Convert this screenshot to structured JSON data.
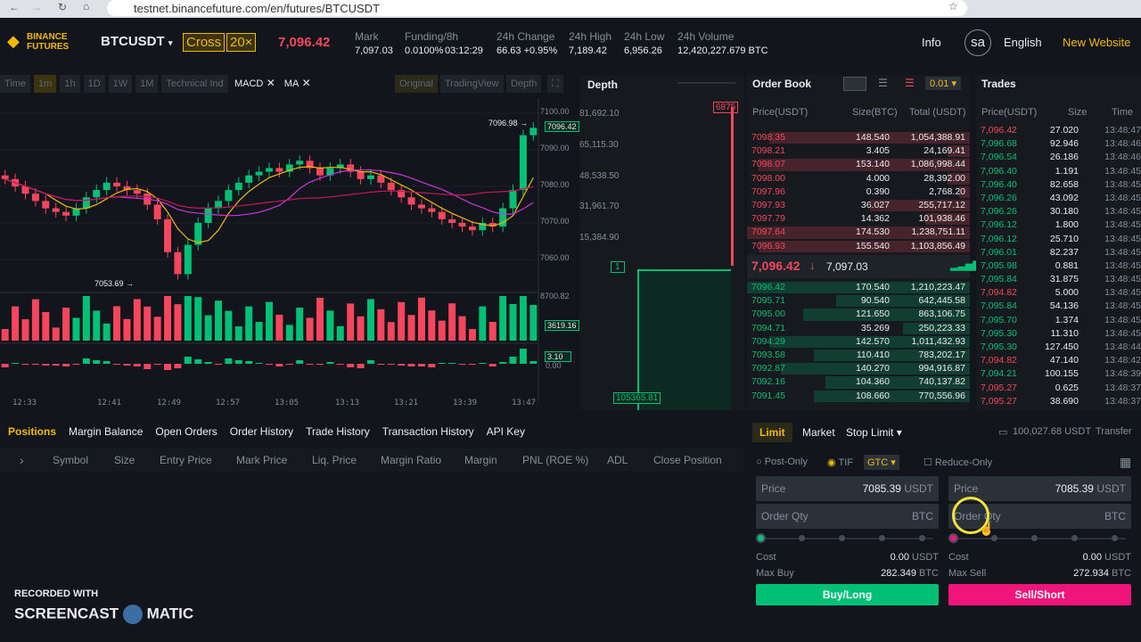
{
  "browser": {
    "url": "testnet.binancefuture.com/en/futures/BTCUSDT"
  },
  "header": {
    "logo": "BINANCE FUTURES",
    "symbol": "BTCUSDT",
    "margin_mode": "Cross",
    "leverage": "20×",
    "last_price": "7,096.42",
    "mark_label": "Mark",
    "mark_value": "7,097.03",
    "funding_label": "Funding/8h",
    "funding_rate": "0.0100%",
    "funding_countdown": "03:12:29",
    "change_label": "24h Change",
    "change_value": "66.63 +0.95%",
    "high_label": "24h High",
    "high_value": "7,189.42",
    "low_label": "24h Low",
    "low_value": "6,956.26",
    "volume_label": "24h Volume",
    "volume_value": "12,420,227.679 BTC",
    "info": "Info",
    "avatar": "sa",
    "language": "English",
    "new_website": "New Website"
  },
  "chart_toolbar": {
    "items": [
      "Time",
      "1m",
      "1h",
      "1D",
      "1W",
      "1M",
      "Technical Ind"
    ],
    "indicators": [
      "MACD",
      "MA"
    ],
    "views": [
      "Original",
      "TradingView",
      "Depth"
    ]
  },
  "chart": {
    "y_ticks": [
      "7100.00",
      "7090.00",
      "7080.00",
      "7070.00",
      "7060.00"
    ],
    "vol_max": "8700.82",
    "current_price_tag": "7096.42",
    "high_marker": "7096.98",
    "low_marker": "7053.69",
    "volume_tag": "3619.16",
    "macd_tag": "3.10",
    "macd_zero": "0.00",
    "x_ticks": [
      "12:33",
      "12:41",
      "12:49",
      "12:57",
      "13:05",
      "13:13",
      "13:21",
      "13:39",
      "13:47"
    ],
    "closes": [
      7082,
      7080,
      7078,
      7076,
      7074,
      7073,
      7072,
      7074,
      7077,
      7079,
      7081,
      7080,
      7079,
      7078,
      7075,
      7071,
      7062,
      7056,
      7064,
      7070,
      7074,
      7076,
      7079,
      7081,
      7083,
      7084,
      7085,
      7084,
      7086,
      7087,
      7085,
      7083,
      7085,
      7086,
      7084,
      7082,
      7083,
      7081,
      7079,
      7077,
      7075,
      7074,
      7073,
      7071,
      7070,
      7069,
      7068,
      7070,
      7069,
      7074,
      7079,
      7094,
      7096
    ]
  },
  "depth": {
    "title": "Depth",
    "y_ticks": [
      "81,692.10",
      "65,115.30",
      "48,538.50",
      "31,961.70",
      "15,384.90"
    ],
    "ask_tag": "6875",
    "bid_tag": "1",
    "bid_total": "105365.81"
  },
  "orderbook": {
    "title": "Order Book",
    "precision": "0.01",
    "headers": [
      "Price(USDT)",
      "Size(BTC)",
      "Total (USDT)"
    ],
    "asks": [
      [
        "7098.35",
        "148.540",
        "1,054,388.91"
      ],
      [
        "7098.21",
        "3.405",
        "24,169.41"
      ],
      [
        "7098.07",
        "153.140",
        "1,086,998.44"
      ],
      [
        "7098.00",
        "4.000",
        "28,392.00"
      ],
      [
        "7097.96",
        "0.390",
        "2,768.20"
      ],
      [
        "7097.93",
        "36.027",
        "255,717.12"
      ],
      [
        "7097.79",
        "14.362",
        "101,938.46"
      ],
      [
        "7097.64",
        "174.530",
        "1,238,751.11"
      ],
      [
        "7096.93",
        "155.540",
        "1,103,856.49"
      ]
    ],
    "last_price": "7,096.42",
    "mark_price": "7,097.03",
    "bids": [
      [
        "7096.42",
        "170.540",
        "1,210,223.47"
      ],
      [
        "7095.71",
        "90.540",
        "642,445.58"
      ],
      [
        "7095.00",
        "121.650",
        "863,106.75"
      ],
      [
        "7094.71",
        "35.269",
        "250,223.33"
      ],
      [
        "7094.29",
        "142.570",
        "1,011,432.93"
      ],
      [
        "7093.58",
        "110.410",
        "783,202.17"
      ],
      [
        "7092.87",
        "140.270",
        "994,916.87"
      ],
      [
        "7092.16",
        "104.360",
        "740,137.82"
      ],
      [
        "7091.45",
        "108.660",
        "770,556.96"
      ]
    ],
    "ask_depth": [
      0.9,
      0.1,
      0.95,
      0.1,
      0.05,
      0.45,
      0.2,
      1,
      0.95
    ],
    "bid_depth": [
      1,
      0.6,
      0.75,
      0.3,
      0.9,
      0.7,
      0.85,
      0.65,
      0.7
    ]
  },
  "trades": {
    "title": "Trades",
    "headers": [
      "Price(USDT)",
      "Size",
      "Time"
    ],
    "rows": [
      [
        "7,096.42",
        "27.020",
        "13:48:47",
        "s"
      ],
      [
        "7,096.68",
        "92.946",
        "13:48:46",
        "b"
      ],
      [
        "7,096.54",
        "26.186",
        "13:48:46",
        "b"
      ],
      [
        "7,096.40",
        "1.191",
        "13:48:45",
        "b"
      ],
      [
        "7,096.40",
        "82.658",
        "13:48:45",
        "b"
      ],
      [
        "7,096.26",
        "43.092",
        "13:48:45",
        "b"
      ],
      [
        "7,096.26",
        "30.180",
        "13:48:45",
        "b"
      ],
      [
        "7,096.12",
        "1.800",
        "13:48:45",
        "b"
      ],
      [
        "7,096.12",
        "25.710",
        "13:48:45",
        "b"
      ],
      [
        "7,096.01",
        "82.237",
        "13:48:45",
        "b"
      ],
      [
        "7,095.98",
        "0.881",
        "13:48:45",
        "b"
      ],
      [
        "7,095.84",
        "31.875",
        "13:48:45",
        "b"
      ],
      [
        "7,094.82",
        "5.000",
        "13:48:45",
        "s"
      ],
      [
        "7,095.84",
        "54.136",
        "13:48:45",
        "b"
      ],
      [
        "7,095.70",
        "1.374",
        "13:48:45",
        "b"
      ],
      [
        "7,095.30",
        "11.310",
        "13:48:45",
        "b"
      ],
      [
        "7,095.30",
        "127.450",
        "13:48:44",
        "b"
      ],
      [
        "7,094.82",
        "47.140",
        "13:48:42",
        "s"
      ],
      [
        "7,094.21",
        "100.155",
        "13:48:39",
        "b"
      ],
      [
        "7,095.27",
        "0.625",
        "13:48:37",
        "s"
      ],
      [
        "7,095.27",
        "38.690",
        "13:48:37",
        "s"
      ]
    ]
  },
  "bottom": {
    "tabs": [
      "Positions",
      "Margin Balance",
      "Open Orders",
      "Order History",
      "Trade History",
      "Transaction History",
      "API Key"
    ],
    "columns": [
      "Symbol",
      "Size",
      "Entry Price",
      "Mark Price",
      "Liq. Price",
      "Margin Ratio",
      "Margin",
      "PNL (ROE %)",
      "ADL",
      "Close Position"
    ]
  },
  "order_form": {
    "types": [
      "Limit",
      "Market",
      "Stop Limit"
    ],
    "balance": "100,027.68 USDT",
    "transfer": "Transfer",
    "post_only": "Post-Only",
    "tif": "TIF",
    "tif_value": "GTC",
    "reduce_only": "Reduce-Only",
    "buy": {
      "price_label": "Price",
      "price": "7085.39",
      "price_unit": "USDT",
      "qty_label": "Order Qty",
      "qty_unit": "BTC",
      "cost_label": "Cost",
      "cost": "0.00",
      "cost_unit": "USDT",
      "max_label": "Max Buy",
      "max": "282.349",
      "max_unit": "BTC",
      "button": "Buy/Long"
    },
    "sell": {
      "price_label": "Price",
      "price": "7085.39",
      "price_unit": "USDT",
      "qty_label": "Order Qty",
      "qty_unit": "BTC",
      "cost_label": "Cost",
      "cost": "0.00",
      "cost_unit": "USDT",
      "max_label": "Max Sell",
      "max": "272.934",
      "max_unit": "BTC",
      "button": "Sell/Short"
    }
  },
  "watermark": {
    "line1": "RECORDED WITH",
    "line2": "SCREENCAST",
    "line3": "MATIC"
  },
  "colors": {
    "up": "#02c076",
    "down": "#f6465d",
    "accent": "#f0b90b"
  }
}
